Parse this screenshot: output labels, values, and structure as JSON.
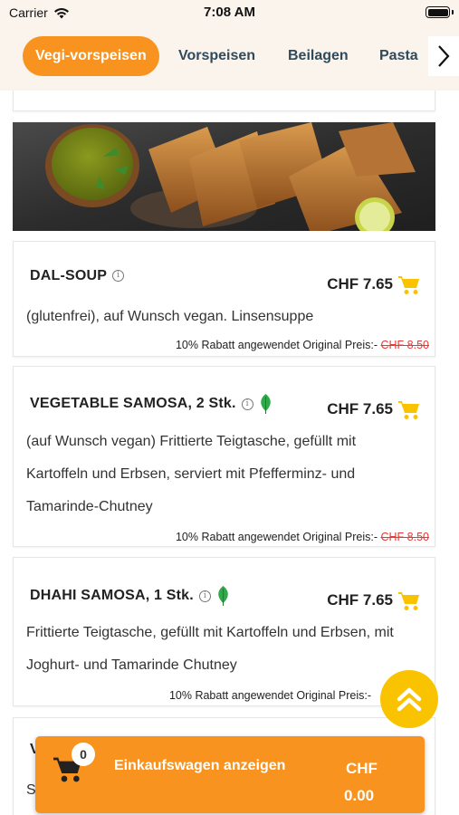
{
  "status_bar": {
    "carrier": "Carrier",
    "time": "7:08 AM"
  },
  "categories": [
    {
      "label": "Vegi-vorspeisen",
      "active": true
    },
    {
      "label": "Vorspeisen",
      "active": false
    },
    {
      "label": "Beilagen",
      "active": false
    },
    {
      "label": "Pasta",
      "active": false
    }
  ],
  "items": [
    {
      "name": "DAL-SOUP",
      "vegan_leaf": false,
      "price": "CHF 7.65",
      "description": "(glutenfrei), auf Wunsch vegan. Linsensuppe",
      "discount_text": "10% Rabatt angewendet Original Preis:-",
      "original_price": "CHF 8.50"
    },
    {
      "name": "VEGETABLE SAMOSA, 2 Stk.",
      "vegan_leaf": true,
      "price": "CHF 7.65",
      "description_lines": [
        "(auf Wunsch vegan) Frittierte Teigtasche, gefüllt mit",
        "Kartoffeln und Erbsen, serviert mit Pfefferminz- und",
        "Tamarinde-Chutney"
      ],
      "discount_text": "10% Rabatt angewendet Original Preis:-",
      "original_price": "CHF 8.50"
    },
    {
      "name": "DHAHI SAMOSA, 1 Stk.",
      "vegan_leaf": true,
      "price": "CHF 7.65",
      "description_lines": [
        "Frittierte Teigtasche, gefüllt mit Kartoffeln und Erbsen, mit",
        "Joghurt- und Tamarinde Chutney"
      ],
      "discount_text": "10% Rabatt angewendet Original Preis:-"
    },
    {
      "name_partial": "V",
      "description_partial": "S"
    }
  ],
  "cart": {
    "count": "0",
    "label": "Einkaufswagen anzeigen",
    "currency": "CHF",
    "total": "0.00"
  },
  "colors": {
    "accent": "#f7931e",
    "cart_icon": "#f9c300",
    "strike_price": "#e53935",
    "nav_text": "#2e4a5c"
  }
}
